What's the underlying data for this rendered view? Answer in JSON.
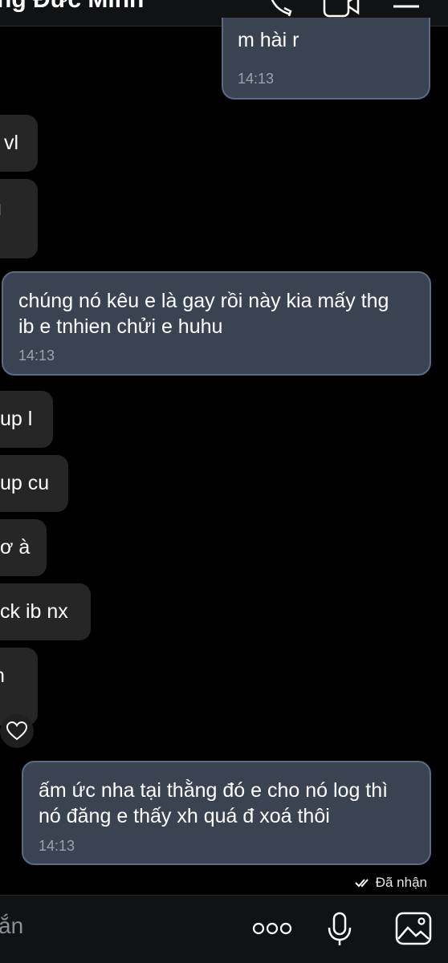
{
  "header": {
    "contact_name": "ng Đức Minh",
    "icons": [
      "phone-icon",
      "video-call-icon",
      "menu-icon"
    ]
  },
  "messages": [
    {
      "side": "mine",
      "text_lines": [
        "m hài r"
      ],
      "time": "14:13"
    },
    {
      "side": "theirs",
      "text": "vl"
    },
    {
      "side": "theirs",
      "text": "u"
    },
    {
      "side": "mine",
      "text_lines": [
        "chúng nó kêu e là gay rồi này kia mấy thg",
        "ib e tnhien chửi e huhu"
      ],
      "time": "14:13"
    },
    {
      "side": "theirs",
      "text": "up l"
    },
    {
      "side": "theirs",
      "text": "up cu"
    },
    {
      "side": "theirs",
      "text": "ơ à"
    },
    {
      "side": "theirs",
      "text": "ck ib nx"
    },
    {
      "side": "theirs",
      "text": "n"
    },
    {
      "side": "mine",
      "text_lines": [
        "ấm ức nha tại thằng đó e cho nó log thì",
        "nó đăng e thấy xh quá đ xoá thôi"
      ],
      "time": "14:13"
    }
  ],
  "status": {
    "label": "Đã nhận"
  },
  "composer": {
    "input_fragment": "ắn",
    "icons": [
      "more-icon",
      "microphone-icon",
      "image-icon"
    ]
  },
  "colors": {
    "background": "#000000",
    "my_bubble": "#3a4352",
    "my_bubble_border": "#5b6b82",
    "their_bubble": "#262626"
  }
}
